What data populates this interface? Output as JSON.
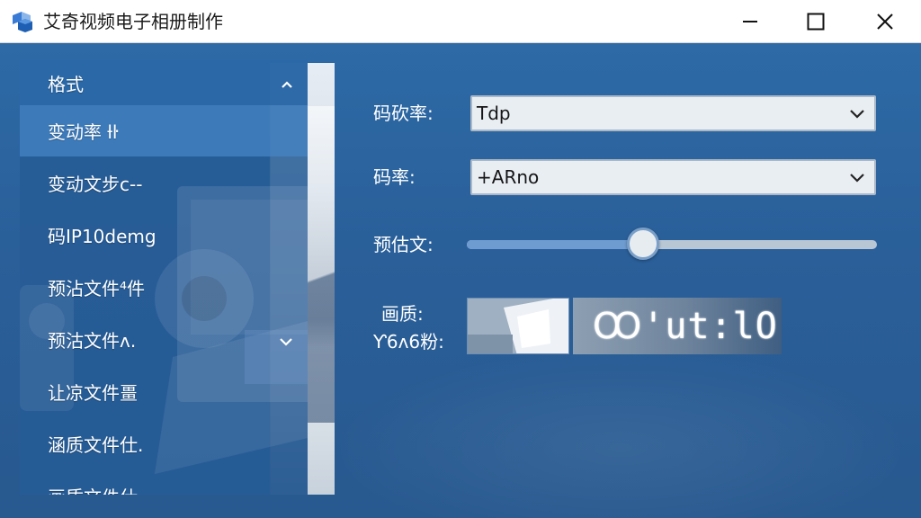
{
  "window": {
    "title": "艾奇视频电子相册制作"
  },
  "sidebar": {
    "items": [
      {
        "label": "格式"
      },
      {
        "label": "变动率 ƚŀ"
      },
      {
        "label": "变动文步ᴄ--"
      },
      {
        "label": "码ⅠP10demg"
      },
      {
        "label": "预沾文件⁴件"
      },
      {
        "label": "预沽文件ᴧ."
      },
      {
        "label": "让凉文件畺"
      },
      {
        "label": "涵质文件仕."
      },
      {
        "label": "画质文件仕"
      }
    ]
  },
  "form": {
    "encoding_label": "码砍率:",
    "encoding_value": "Tdp",
    "bitrate_label": "码率:",
    "bitrate_value": "+ARno",
    "estimate_label": "预估文:",
    "estimate_slider": 0.43,
    "quality_label_line1": "画质:",
    "quality_label_line2": "Ƴ6ᴧ6粉:",
    "quality_readout": "Ꝏ'ut:lO"
  },
  "colors": {
    "titlebar": "#ffffff",
    "background": "#2c5f95",
    "sidebar": "#265c96",
    "accent": "#6f9cd0"
  },
  "icons": {
    "app": "app-cube-icon",
    "minimize": "minimize-icon",
    "maximize": "maximize-icon",
    "close": "close-icon"
  }
}
